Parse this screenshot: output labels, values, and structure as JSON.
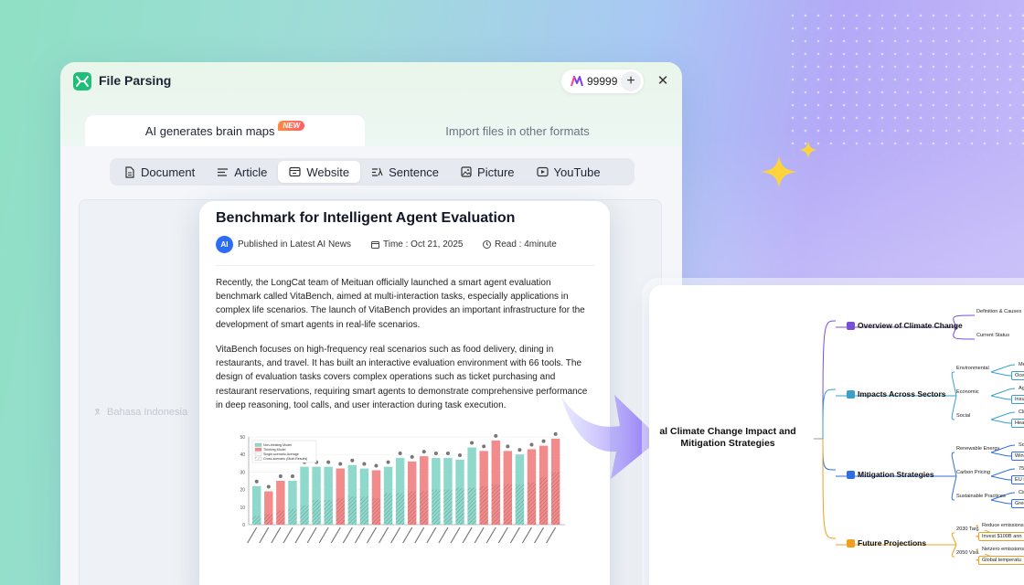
{
  "window": {
    "title": "File Parsing",
    "credits": "99999",
    "plus_symbol": "+",
    "close_symbol": "✕"
  },
  "tabs": [
    {
      "label": "AI generates brain maps",
      "badge": "NEW"
    },
    {
      "label": "Import files in other formats"
    }
  ],
  "source_types": [
    {
      "label": "Document",
      "icon": "document-icon"
    },
    {
      "label": "Article",
      "icon": "article-icon"
    },
    {
      "label": "Website",
      "icon": "website-icon",
      "active": true
    },
    {
      "label": "Sentence",
      "icon": "sentence-icon"
    },
    {
      "label": "Picture",
      "icon": "picture-icon"
    },
    {
      "label": "YouTube",
      "icon": "youtube-icon"
    }
  ],
  "language_hint": "Bahasa Indonesia",
  "article": {
    "title": "Benchmark for Intelligent Agent Evaluation",
    "avatar_text": "AI",
    "published": "Published in Latest AI News",
    "time": "Time : Oct 21, 2025",
    "read": "Read : 4minute",
    "paragraph1": "Recently, the LongCat team of Meituan officially launched a smart agent evaluation benchmark called VitaBench, aimed at multi-interaction tasks, especially applications in complex life scenarios. The launch of VitaBench provides an important infrastructure for the development of smart agents in real-life scenarios.",
    "paragraph2": "VitaBench focuses on high-frequency real scenarios such as food delivery, dining in restaurants, and travel. It has built an interactive evaluation environment with 66 tools. The design of evaluation tasks covers complex operations such as ticket purchasing and restaurant reservations, requiring smart agents to demonstrate comprehensive performance in deep reasoning, tool calls, and user interaction during task execution."
  },
  "chart_data": {
    "type": "bar",
    "title": "",
    "ylim": [
      0,
      50
    ],
    "yticks": [
      0,
      10,
      20,
      30,
      40,
      50
    ],
    "legend": [
      "Non-thinking Model",
      "Thinking Model",
      "Single-scenario Average",
      "Cross-scenario (Multi-Results)"
    ],
    "legend_position": "top-left",
    "colors": {
      "non_thinking": "#8fd8cc",
      "thinking": "#f28b8b"
    },
    "series": [
      {
        "name": "total",
        "values": [
          22,
          19,
          25,
          25,
          33,
          33,
          33,
          32,
          34,
          32,
          31,
          33,
          38,
          36,
          39,
          38,
          38,
          37,
          44,
          42,
          48,
          42,
          40,
          43,
          45,
          49
        ]
      },
      {
        "name": "cross",
        "values": [
          5,
          6,
          8,
          9,
          11,
          14,
          14,
          15,
          16,
          16,
          15,
          18,
          18,
          19,
          19,
          20,
          20,
          21,
          21,
          22,
          23,
          23,
          23,
          24,
          27,
          30
        ]
      }
    ],
    "thinking_flags": [
      0,
      1,
      1,
      0,
      0,
      0,
      0,
      1,
      0,
      0,
      1,
      0,
      0,
      1,
      1,
      0,
      0,
      0,
      0,
      1,
      1,
      1,
      0,
      1,
      1,
      1
    ]
  },
  "mindmap": {
    "root": "al Climate Change Impact and Mitigation Strategies",
    "branches": [
      {
        "label": "Overview of Climate Change",
        "color": "#7a4fd6",
        "subs": [
          "Definition & Causes",
          "Current Status"
        ],
        "leaves": []
      },
      {
        "label": "Impacts Across Sectors",
        "color": "#3aa0c8",
        "subs": [
          "Environmental",
          "Economic",
          "Social"
        ],
        "leaves": [
          "Melting",
          "Ocean a",
          "Agricultural",
          "Insurance co",
          "Climate refugees",
          "Health risk heat"
        ]
      },
      {
        "label": "Mitigation Strategies",
        "color": "#2f6fe0",
        "subs": [
          "Renewable Energy",
          "Carbon Pricing",
          "Sustainable Practices"
        ],
        "leaves": [
          "Solar ca",
          "Wind p",
          "75+ countr",
          "EU ETS redu",
          "Circ",
          "Green"
        ]
      },
      {
        "label": "Future Projections",
        "color": "#f0a020",
        "subs": [
          "2030 Targets",
          "2050 Vision"
        ],
        "leaves": [
          "Reduce emissions",
          "Invest $100B ann",
          "Netzero emissions",
          "Global temperatu"
        ]
      }
    ]
  }
}
